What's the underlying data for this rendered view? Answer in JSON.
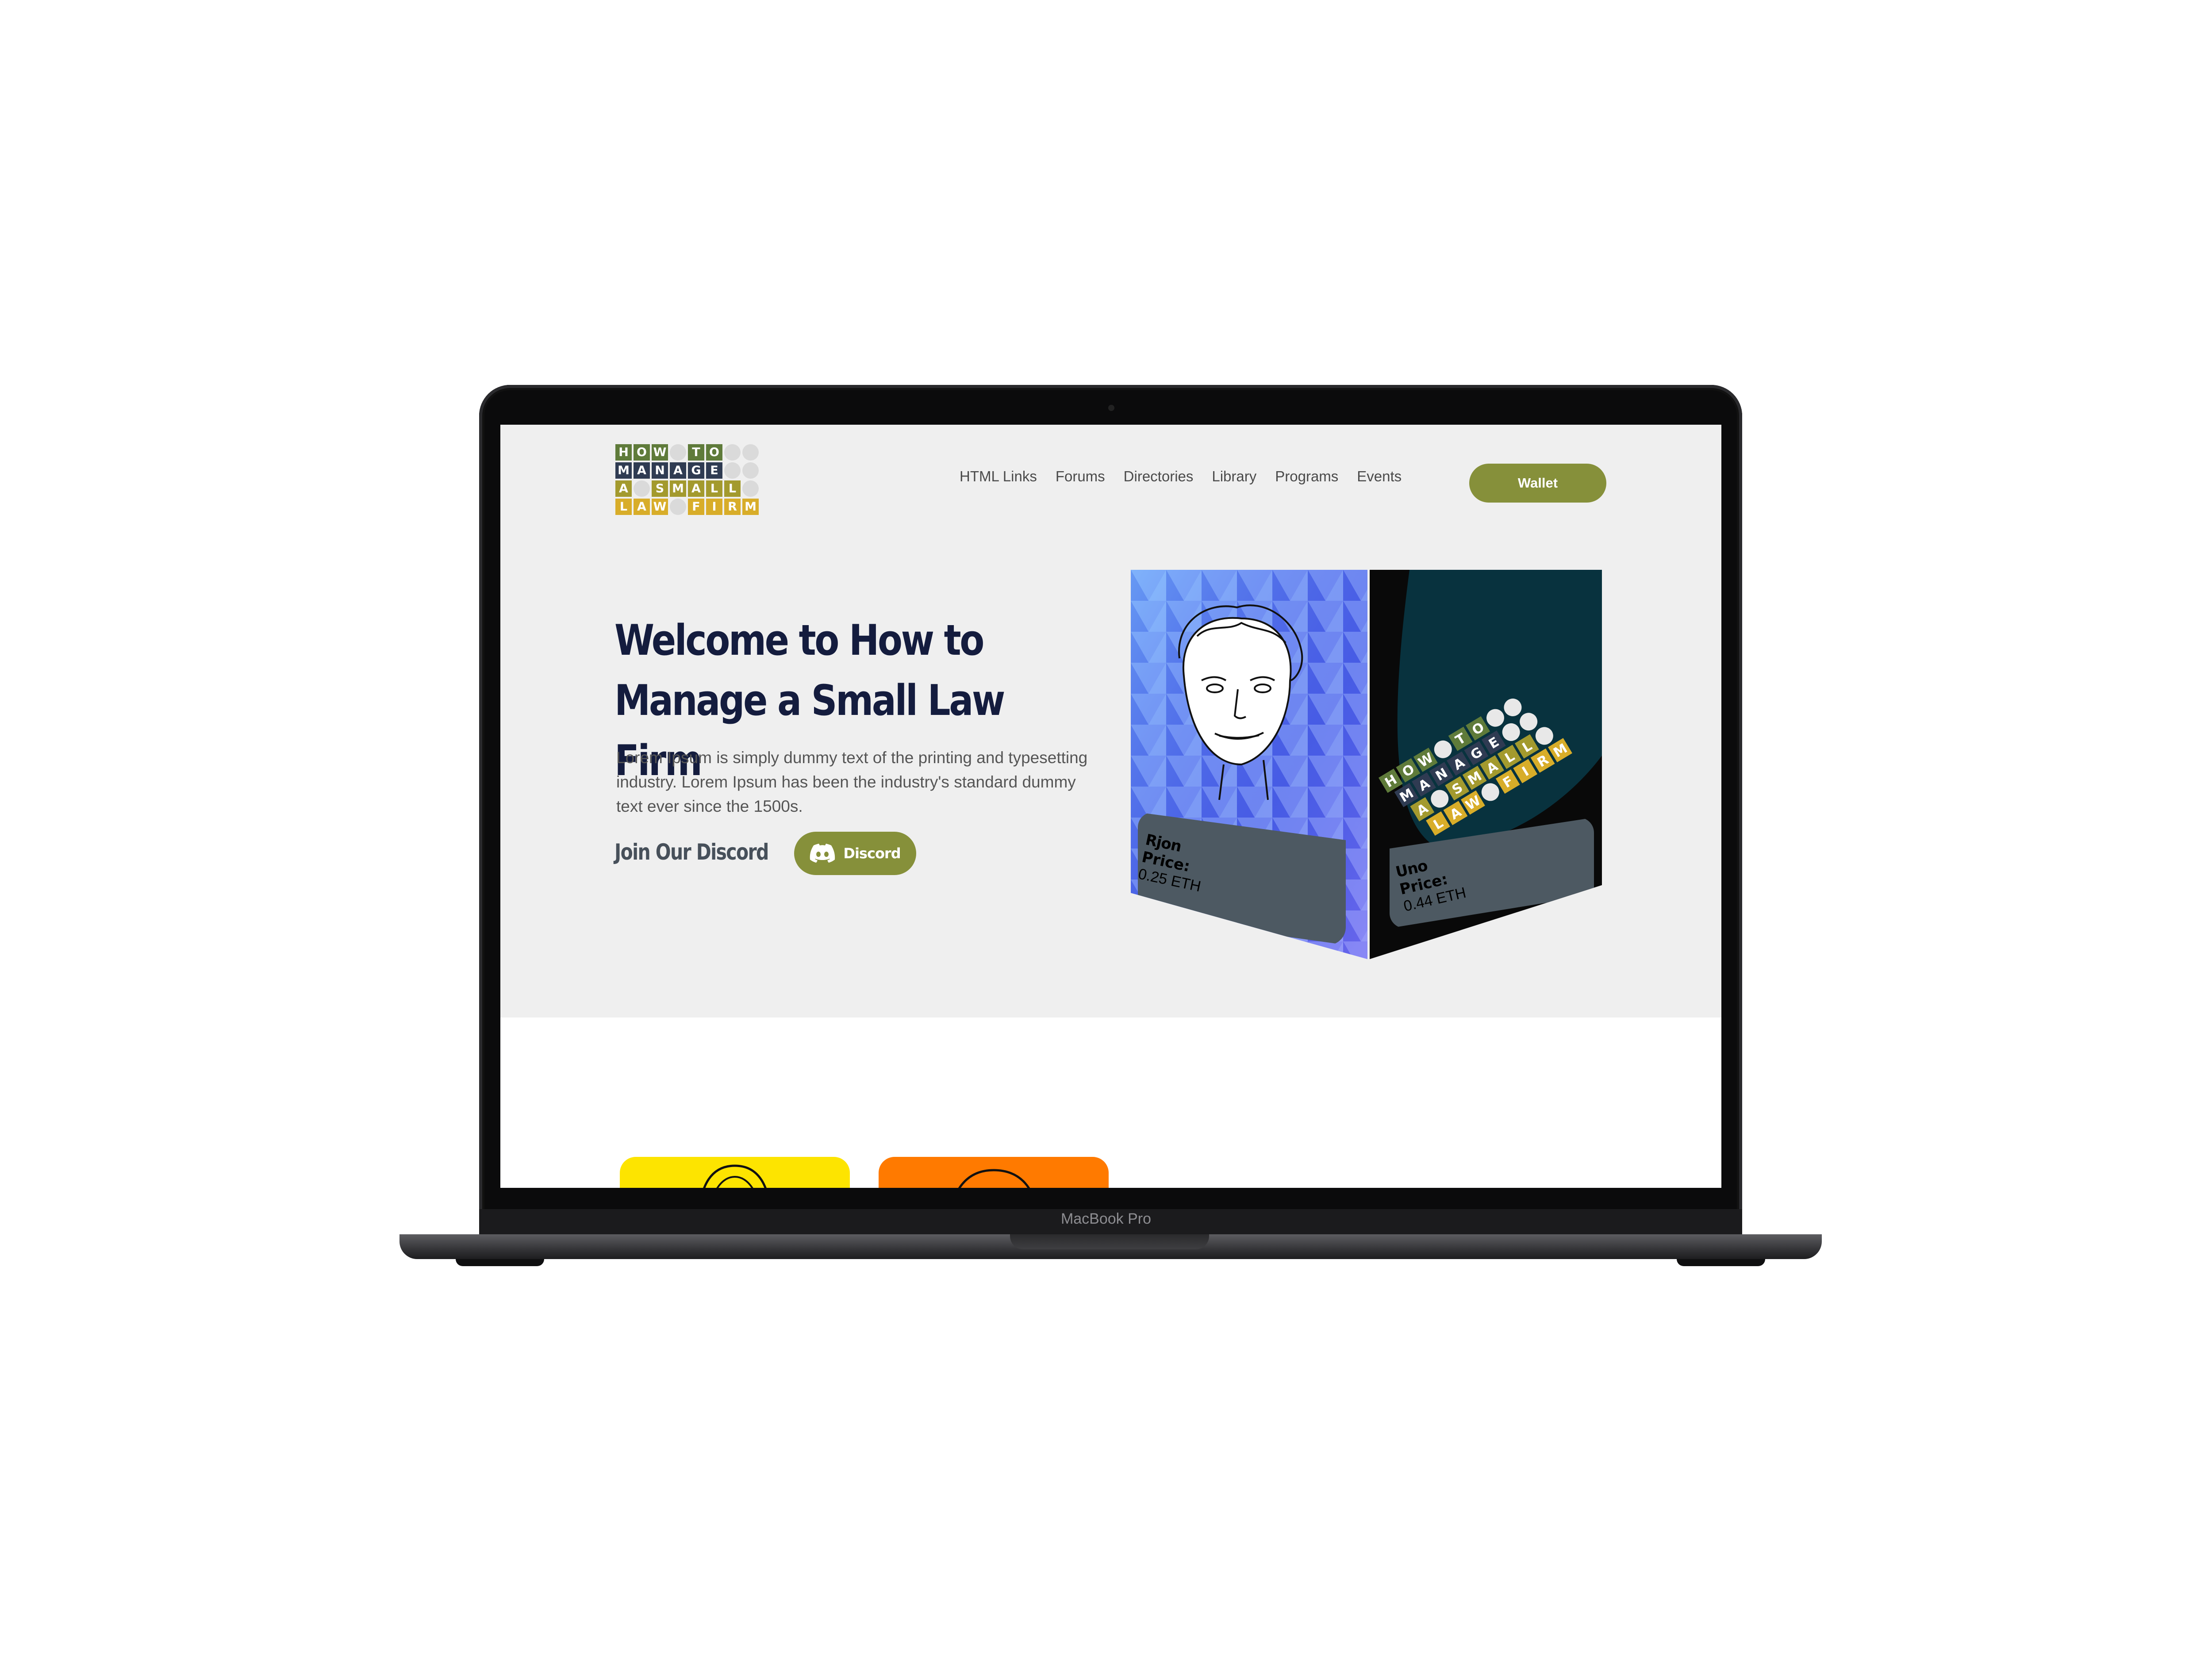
{
  "device": {
    "model_label": "MacBook Pro"
  },
  "logo": {
    "rows": [
      [
        "H",
        "O",
        "W",
        "",
        "T",
        "O",
        "",
        ""
      ],
      [
        "M",
        "A",
        "N",
        "A",
        "G",
        "E",
        "",
        ""
      ],
      [
        "A",
        "",
        "S",
        "M",
        "A",
        "L",
        "L",
        ""
      ],
      [
        "L",
        "A",
        "W",
        "",
        "F",
        "I",
        "R",
        "M"
      ]
    ]
  },
  "nav": {
    "links": [
      "HTML Links",
      "Forums",
      "Directories",
      "Library",
      "Programs",
      "Events"
    ],
    "wallet_label": "Wallet"
  },
  "hero": {
    "title_line1": "Welcome to How to",
    "title_line2": "Manage a Small Law Firm",
    "description": "Lorem Ipsum is simply dummy text of the printing and typesetting industry. Lorem Ipsum has been the industry's standard dummy text ever since the 1500s.",
    "discord_prompt": "Join Our Discord",
    "discord_button": "Discord"
  },
  "nft_cards": [
    {
      "name": "Rjon",
      "price_label": "Price:",
      "price": "0.25 ETH"
    },
    {
      "name": "Uno",
      "price_label": "Price:",
      "price": "0.44 ETH"
    }
  ],
  "colors": {
    "accent": "#86903a",
    "heading": "#141c3e",
    "hero_bg": "#efefef",
    "card_yellow": "#fde400",
    "card_orange": "#ff7a00"
  }
}
